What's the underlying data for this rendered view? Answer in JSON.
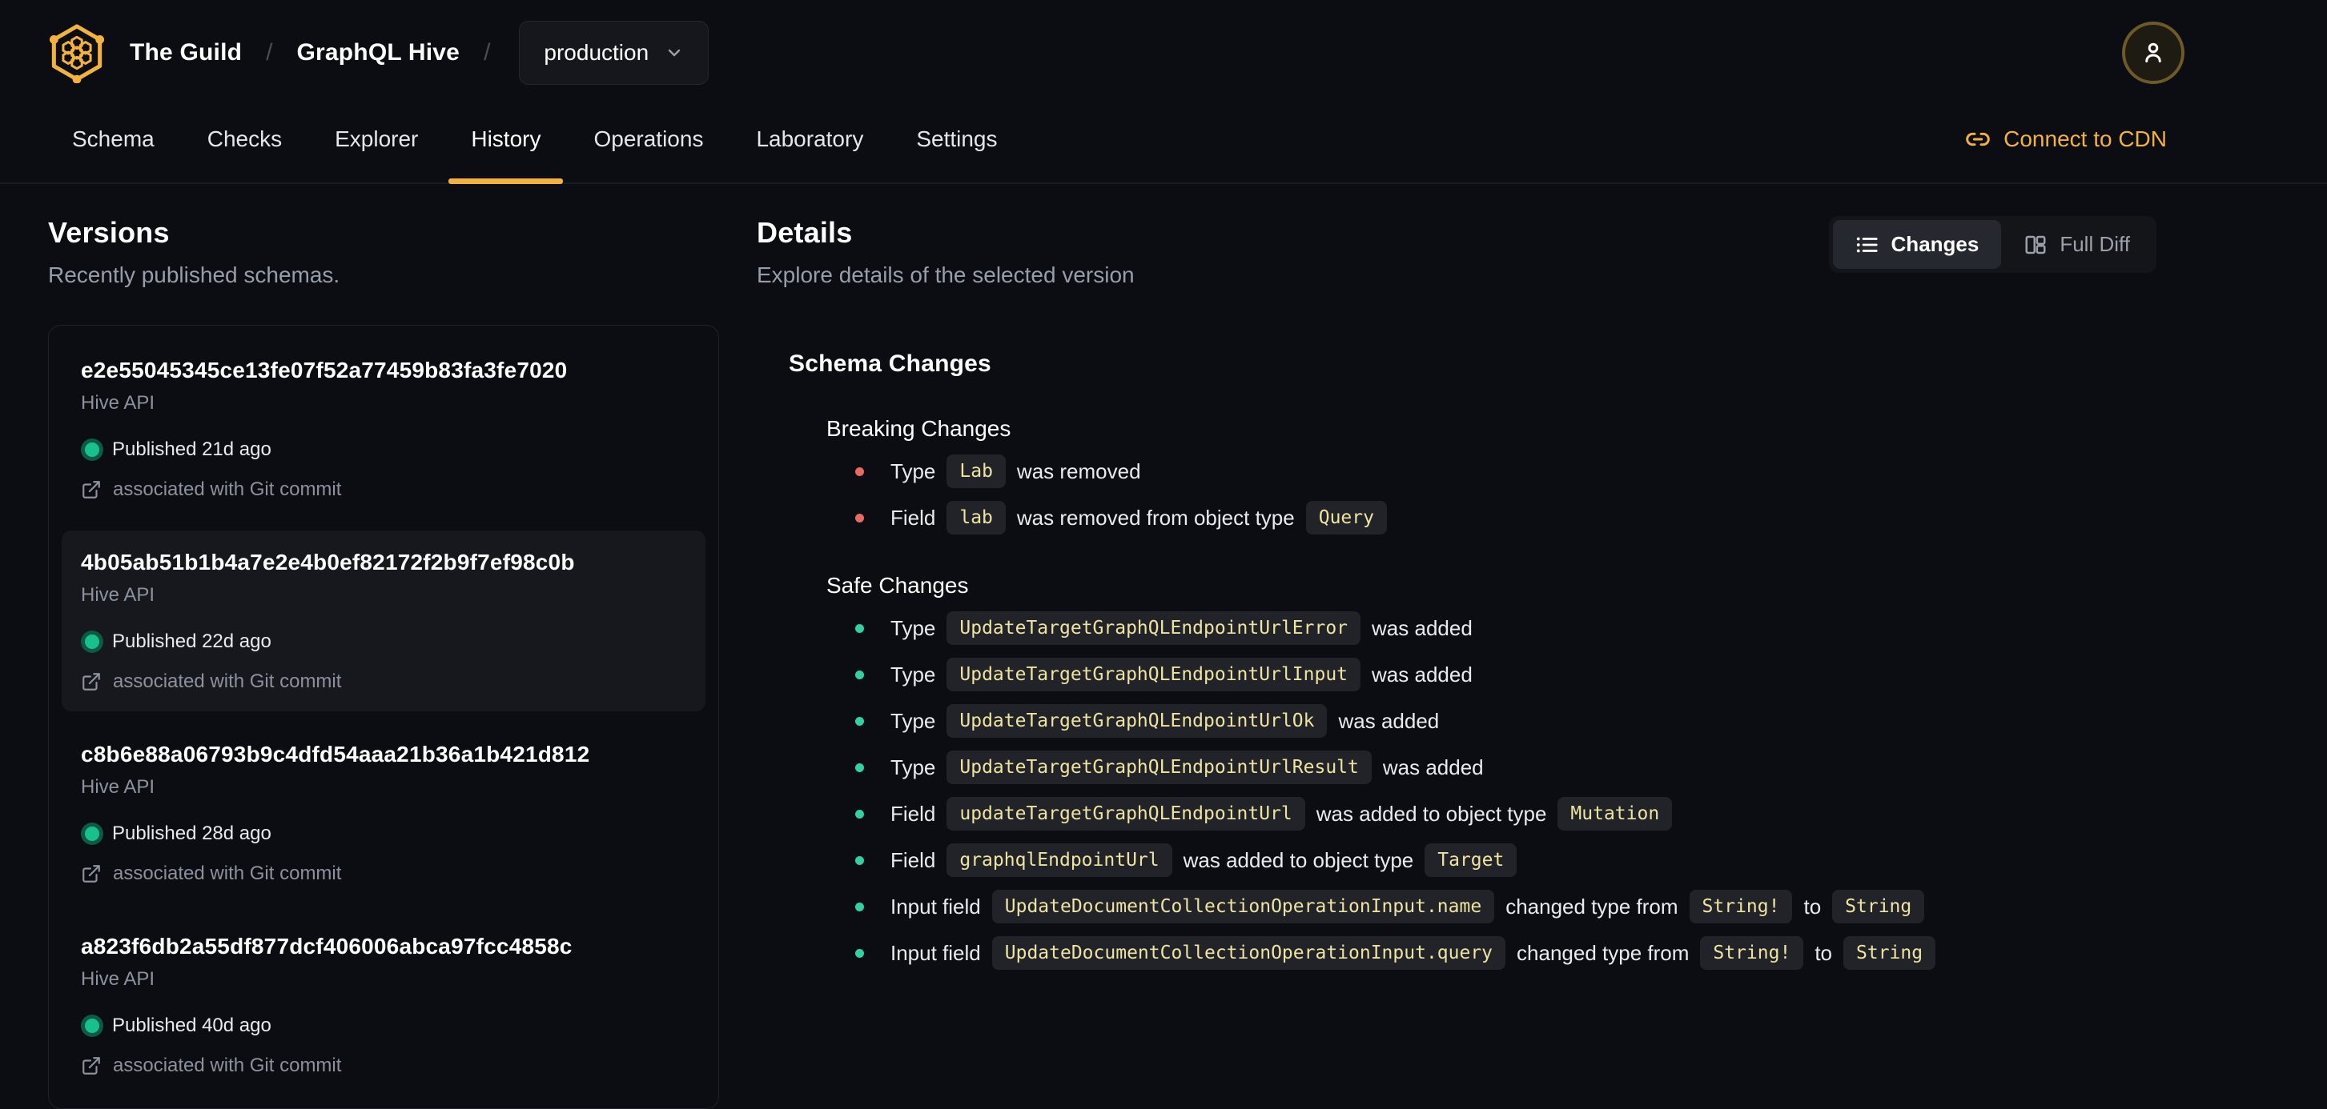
{
  "header": {
    "org": "The Guild",
    "separator": "/",
    "project": "GraphQL Hive",
    "target_selector": "production"
  },
  "nav": {
    "tabs": [
      {
        "label": "Schema",
        "active": false
      },
      {
        "label": "Checks",
        "active": false
      },
      {
        "label": "Explorer",
        "active": false
      },
      {
        "label": "History",
        "active": true
      },
      {
        "label": "Operations",
        "active": false
      },
      {
        "label": "Laboratory",
        "active": false
      },
      {
        "label": "Settings",
        "active": false
      }
    ],
    "connect_cdn_label": "Connect to CDN"
  },
  "versions": {
    "title": "Versions",
    "subtitle": "Recently published schemas.",
    "items": [
      {
        "hash": "e2e55045345ce13fe07f52a77459b83fa3fe7020",
        "service": "Hive API",
        "status": "Published 21d ago",
        "git": "associated with Git commit",
        "selected": false
      },
      {
        "hash": "4b05ab51b1b4a7e2e4b0ef82172f2b9f7ef98c0b",
        "service": "Hive API",
        "status": "Published 22d ago",
        "git": "associated with Git commit",
        "selected": true
      },
      {
        "hash": "c8b6e88a06793b9c4dfd54aaa21b36a1b421d812",
        "service": "Hive API",
        "status": "Published 28d ago",
        "git": "associated with Git commit",
        "selected": false
      },
      {
        "hash": "a823f6db2a55df877dcf406006abca97fcc4858c",
        "service": "Hive API",
        "status": "Published 40d ago",
        "git": "associated with Git commit",
        "selected": false
      }
    ]
  },
  "details": {
    "title": "Details",
    "subtitle": "Explore details of the selected version",
    "view_toggle": {
      "changes_label": "Changes",
      "full_diff_label": "Full Diff"
    },
    "schema_changes_title": "Schema Changes",
    "sections": [
      {
        "title": "Breaking Changes",
        "kind": "breaking",
        "items": [
          [
            {
              "v": "Type"
            },
            {
              "v": "Lab",
              "code": true
            },
            {
              "v": "was removed"
            }
          ],
          [
            {
              "v": "Field"
            },
            {
              "v": "lab",
              "code": true
            },
            {
              "v": "was removed from object type"
            },
            {
              "v": "Query",
              "code": true
            }
          ]
        ]
      },
      {
        "title": "Safe Changes",
        "kind": "safe",
        "items": [
          [
            {
              "v": "Type"
            },
            {
              "v": "UpdateTargetGraphQLEndpointUrlError",
              "code": true
            },
            {
              "v": "was added"
            }
          ],
          [
            {
              "v": "Type"
            },
            {
              "v": "UpdateTargetGraphQLEndpointUrlInput",
              "code": true
            },
            {
              "v": "was added"
            }
          ],
          [
            {
              "v": "Type"
            },
            {
              "v": "UpdateTargetGraphQLEndpointUrlOk",
              "code": true
            },
            {
              "v": "was added"
            }
          ],
          [
            {
              "v": "Type"
            },
            {
              "v": "UpdateTargetGraphQLEndpointUrlResult",
              "code": true
            },
            {
              "v": "was added"
            }
          ],
          [
            {
              "v": "Field"
            },
            {
              "v": "updateTargetGraphQLEndpointUrl",
              "code": true
            },
            {
              "v": "was added to object type"
            },
            {
              "v": "Mutation",
              "code": true
            }
          ],
          [
            {
              "v": "Field"
            },
            {
              "v": "graphqlEndpointUrl",
              "code": true
            },
            {
              "v": "was added to object type"
            },
            {
              "v": "Target",
              "code": true
            }
          ],
          [
            {
              "v": "Input field"
            },
            {
              "v": "UpdateDocumentCollectionOperationInput.name",
              "code": true
            },
            {
              "v": "changed type from"
            },
            {
              "v": "String!",
              "code": true
            },
            {
              "v": "to"
            },
            {
              "v": "String",
              "code": true
            }
          ],
          [
            {
              "v": "Input field"
            },
            {
              "v": "UpdateDocumentCollectionOperationInput.query",
              "code": true
            },
            {
              "v": "changed type from"
            },
            {
              "v": "String!",
              "code": true
            },
            {
              "v": "to"
            },
            {
              "v": "String",
              "code": true
            }
          ]
        ]
      }
    ]
  },
  "colors": {
    "accent": "#f2b23c",
    "background": "#0b0d12",
    "breaking_bullet": "#e86a63",
    "safe_bullet": "#30d3a0",
    "code_text": "#efe3a2",
    "code_background": "#212329",
    "published_dot": "#16c18c"
  },
  "icons": {
    "logo": "hive-honeycomb-logo",
    "user": "user-icon",
    "chevron": "chevron-down-icon",
    "cdn": "link-icon",
    "changes": "list-icon",
    "full_diff": "columns-icon",
    "git": "external-link-icon",
    "published": "status-dot"
  }
}
